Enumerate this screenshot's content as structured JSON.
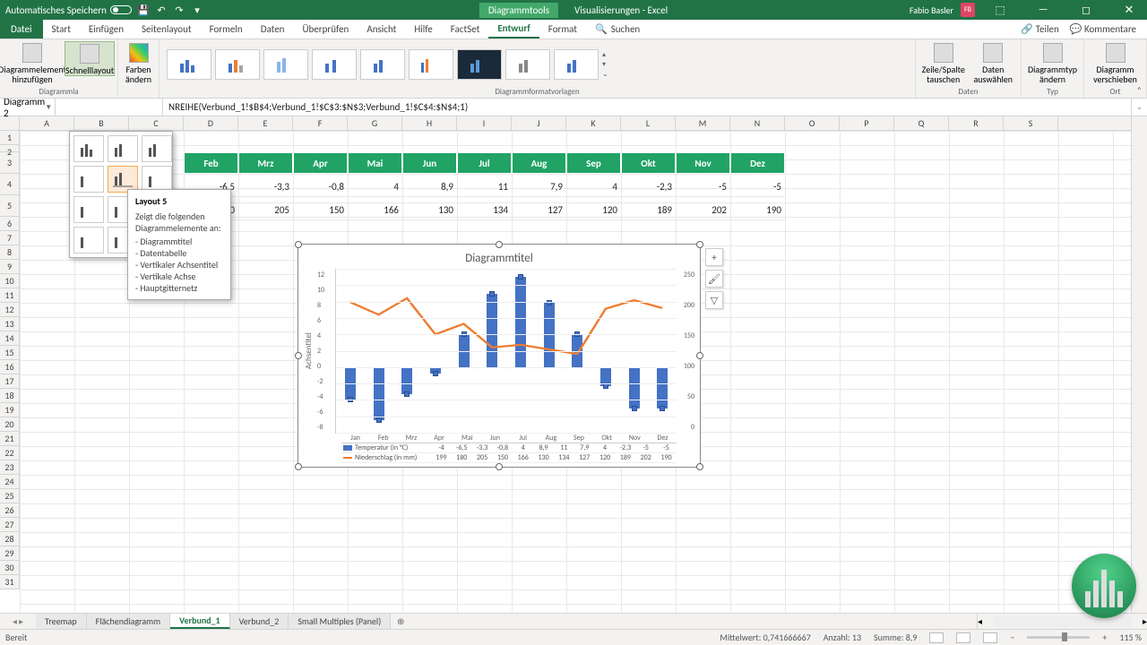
{
  "titlebar": {
    "autosave_label": "Automatisches Speichern",
    "tool_context": "Diagrammtools",
    "doc_title": "Visualisierungen - Excel",
    "user_name": "Fabio Basler",
    "user_initials": "FB"
  },
  "ribbon": {
    "file": "Datei",
    "tabs": [
      "Start",
      "Einfügen",
      "Seitenlayout",
      "Formeln",
      "Daten",
      "Überprüfen",
      "Ansicht",
      "Hilfe",
      "FactSet",
      "Entwurf",
      "Format"
    ],
    "active_tab": "Entwurf",
    "search": "Suchen",
    "share": "Teilen",
    "comments": "Kommentare",
    "groups": {
      "layouts_label": "Diagrammla",
      "add_element": "Diagrammelement hinzufügen",
      "quick_layout": "Schnelllayout",
      "change_colors": "Farben ändern",
      "styles_label": "Diagrammformatvorlagen",
      "switch_rowcol": "Zeile/Spalte tauschen",
      "select_data": "Daten auswählen",
      "data_label": "Daten",
      "change_type": "Diagrammtyp ändern",
      "type_label": "Typ",
      "move_chart": "Diagramm verschieben",
      "location_label": "Ort"
    }
  },
  "tooltip": {
    "title": "Layout 5",
    "subtitle": "Zeigt die folgenden Diagrammelemente an:",
    "items": [
      "Diagrammtitel",
      "Datentabelle",
      "Vertikaler Achsentitel",
      "Vertikale Achse",
      "Hauptgitternetz"
    ]
  },
  "name_box": "Diagramm 2",
  "formula": "NREIHE(Verbund_1!$B$4;Verbund_1!$C$3:$N$3;Verbund_1!$C$4:$N$4;1)",
  "columns": [
    "A",
    "B",
    "C",
    "D",
    "E",
    "F",
    "G",
    "H",
    "I",
    "J",
    "K",
    "L",
    "M",
    "N",
    "O",
    "P",
    "Q",
    "R",
    "S"
  ],
  "rows": [
    1,
    2,
    3,
    4,
    5,
    6,
    7,
    8,
    9,
    10,
    11,
    12,
    13,
    14,
    15,
    16,
    17,
    18,
    19,
    20,
    21,
    22,
    23,
    24,
    25,
    26,
    27,
    28,
    29,
    30,
    31
  ],
  "table": {
    "row_label_a": "Niederschlag",
    "months": [
      "Feb",
      "Mrz",
      "Apr",
      "Mai",
      "Jun",
      "Jul",
      "Aug",
      "Sep",
      "Okt",
      "Nov",
      "Dez"
    ],
    "temps": [
      -6.5,
      -3.3,
      -0.8,
      4,
      8.9,
      11,
      7.9,
      4,
      -2.3,
      -5,
      -5
    ],
    "precip": [
      180,
      205,
      150,
      166,
      130,
      134,
      127,
      120,
      189,
      202,
      190
    ]
  },
  "chart_data": {
    "type": "combo",
    "title": "Diagrammtitel",
    "y_axis_label": "Achsentitel",
    "categories": [
      "Jan",
      "Feb",
      "Mrz",
      "Apr",
      "Mai",
      "Jun",
      "Jul",
      "Aug",
      "Sep",
      "Okt",
      "Nov",
      "Dez"
    ],
    "series": [
      {
        "name": "Temperatur (in °C)",
        "type": "bar",
        "axis": "primary",
        "color": "#4472c4",
        "values": [
          -4,
          -6.5,
          -3.3,
          -0.8,
          4,
          8.9,
          11,
          7.9,
          4,
          -2.3,
          -5,
          -5
        ]
      },
      {
        "name": "Niederschlag (in mm)",
        "type": "line",
        "axis": "secondary",
        "color": "#ed7d31",
        "values": [
          199,
          180,
          205,
          150,
          166,
          130,
          134,
          127,
          120,
          189,
          202,
          190
        ]
      }
    ],
    "primary_axis": {
      "min": -8,
      "max": 12,
      "ticks": [
        12,
        10,
        8,
        6,
        4,
        2,
        0,
        -2,
        -4,
        -6,
        -8
      ]
    },
    "secondary_axis": {
      "min": 0,
      "max": 250,
      "ticks": [
        250,
        200,
        150,
        100,
        50,
        0
      ]
    }
  },
  "sheets": {
    "tabs": [
      "Treemap",
      "Flächendiagramm",
      "Verbund_1",
      "Verbund_2",
      "Small Multiples (Panel)"
    ],
    "active": "Verbund_1"
  },
  "status": {
    "ready": "Bereit",
    "avg_label": "Mittelwert:",
    "avg_value": "0,741666667",
    "count_label": "Anzahl:",
    "count_value": "13",
    "sum_label": "Summe:",
    "sum_value": "8,9",
    "zoom": "115 %"
  }
}
